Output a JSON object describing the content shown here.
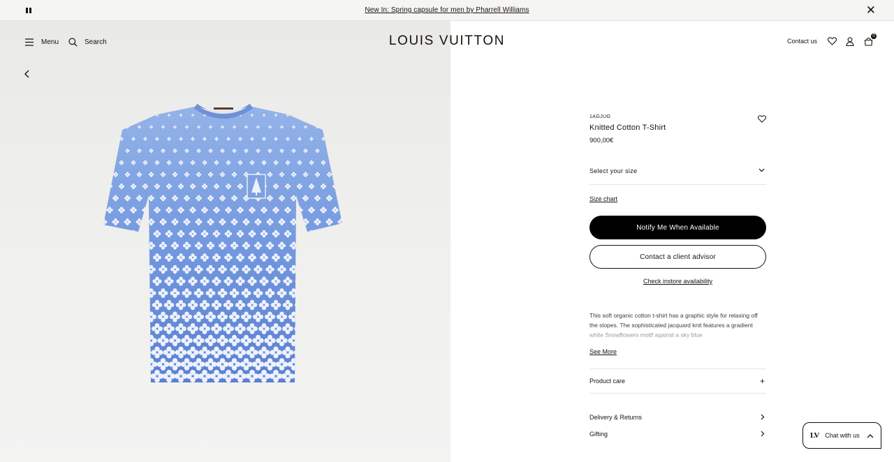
{
  "announcement": {
    "text": "New In: Spring capsule for men by Pharrell Williams",
    "pause_icon": "pause-icon",
    "close_icon": "close-icon",
    "close_glyph": "✕"
  },
  "header": {
    "menu_label": "Menu",
    "search_label": "Search",
    "logo": "LOUIS VUITTON",
    "contact_label": "Contact us",
    "bag_count": "0"
  },
  "product": {
    "sku": "1AGJUG",
    "name": "Knitted Cotton T-Shirt",
    "price": "900,00€",
    "select_size_label": "Select your size",
    "size_chart_label": "Size chart",
    "notify_label": "Notify Me When Available",
    "contact_advisor_label": "Contact a client advisor",
    "instore_label": "Check instore availability",
    "description": "This soft organic cotton t-shirt has a graphic style for relaxing off the slopes. The sophisticated jacquard knit features a gradient white Snowflowers motif against a sky blue",
    "see_more_label": "See More",
    "product_care_label": "Product care",
    "delivery_label": "Delivery & Returns",
    "gifting_label": "Gifting"
  },
  "chat": {
    "label": "Chat with us"
  },
  "colors": {
    "ink": "#19110b",
    "shirt_top": "#8fb0e6",
    "shirt_bottom": "#5a7fd3",
    "motif": "#eef2fb"
  }
}
